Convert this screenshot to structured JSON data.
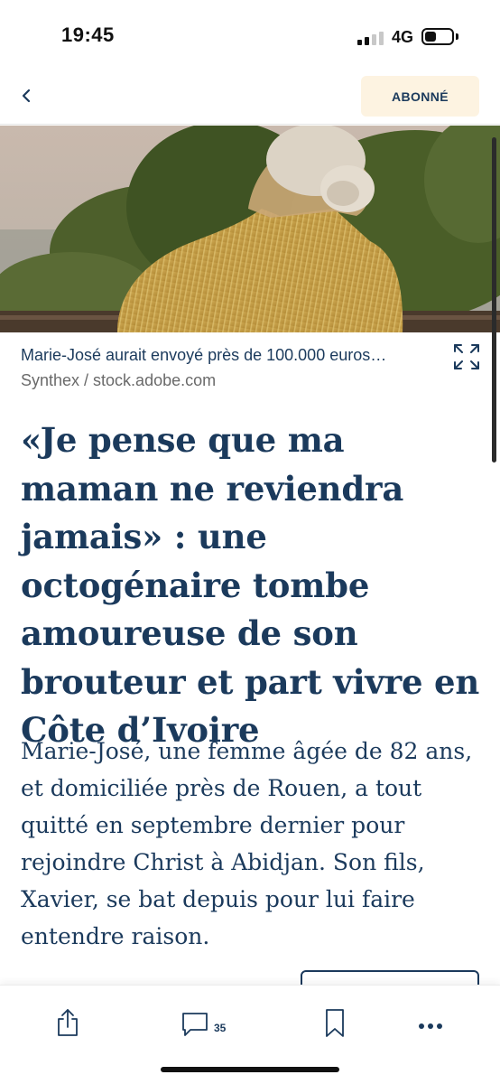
{
  "status_bar": {
    "time": "19:45",
    "network": "4G",
    "signal_bars": 4,
    "signal_bars_active": 2
  },
  "nav": {
    "back_icon": "chevron-left-icon",
    "subscribe_label": "ABONNÉ"
  },
  "hero_image": {
    "description_icon": "photo",
    "caption": "Marie-José aurait envoyé près de 100.000 euros…",
    "credit": "Synthex / stock.adobe.com",
    "expand_icon": "expand-icon"
  },
  "article": {
    "headline": "«Je pense que ma maman ne reviendra jamais» : une octogénaire tombe amoureuse de son brouteur et part vivre en Côte d’Ivoire",
    "lead": "Marie-José, une femme âgée de 82 ans, et domiciliée près de Rouen, a tout quitté en septembre dernier pour rejoindre Christ à Abidjan. Son fils, Xavier, se bat depuis pour lui faire entendre raison."
  },
  "toolbar": {
    "share_icon": "share-icon",
    "comment_icon": "comment-icon",
    "comment_count": "35",
    "bookmark_icon": "bookmark-icon",
    "more_icon": "more-icon"
  },
  "colors": {
    "primary": "#1b3a5c",
    "subscribe_bg": "#fdf3e1",
    "muted": "#6a6a6a"
  }
}
